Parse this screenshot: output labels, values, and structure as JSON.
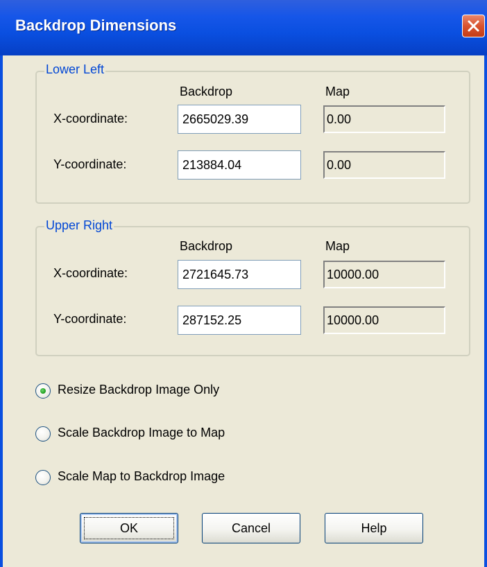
{
  "window": {
    "title": "Backdrop Dimensions",
    "close_icon": "close-icon"
  },
  "lower_left": {
    "legend": "Lower Left",
    "backdrop_header": "Backdrop",
    "map_header": "Map",
    "x_label": "X-coordinate:",
    "y_label": "Y-coordinate:",
    "x_backdrop": "2665029.39",
    "y_backdrop": "213884.04",
    "x_map": "0.00",
    "y_map": "0.00"
  },
  "upper_right": {
    "legend": "Upper Right",
    "backdrop_header": "Backdrop",
    "map_header": "Map",
    "x_label": "X-coordinate:",
    "y_label": "Y-coordinate:",
    "x_backdrop": "2721645.73",
    "y_backdrop": "287152.25",
    "x_map": "10000.00",
    "y_map": "10000.00"
  },
  "options": {
    "selected": 0,
    "items": [
      "Resize Backdrop Image Only",
      "Scale Backdrop Image to Map",
      "Scale Map to Backdrop Image"
    ]
  },
  "buttons": {
    "ok": "OK",
    "cancel": "Cancel",
    "help": "Help"
  },
  "colors": {
    "title_bar": "#0a4fe0",
    "close_button": "#d9532f",
    "dialog_face": "#ece9d8",
    "group_legend": "#0046d5",
    "radio_selected": "#21a121"
  }
}
